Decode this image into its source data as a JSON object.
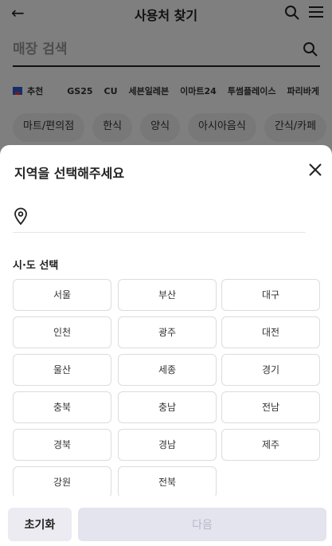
{
  "header": {
    "title": "사용처 찾기",
    "back_icon": "back-arrow-icon",
    "search_icon": "search-icon",
    "menu_icon": "menu-icon"
  },
  "search": {
    "placeholder": "매장 검색",
    "value": ""
  },
  "brands": {
    "recommend_label": "추천",
    "items": [
      "GS25",
      "CU",
      "세븐일레븐",
      "이마트24",
      "투썸플레이스",
      "파리바게"
    ]
  },
  "categories": [
    "마트/편의점",
    "한식",
    "양식",
    "아시아음식",
    "간식/카페"
  ],
  "sheet": {
    "title": "지역을 선택해주세요",
    "close_icon": "close-icon",
    "location_icon": "location-pin-icon",
    "location_value": "",
    "section_title": "시·도 선택",
    "regions": [
      "서울",
      "부산",
      "대구",
      "인천",
      "광주",
      "대전",
      "울산",
      "세종",
      "경기",
      "충북",
      "충남",
      "전남",
      "경북",
      "경남",
      "제주",
      "강원",
      "전북"
    ]
  },
  "footer": {
    "reset_label": "초기화",
    "next_label": "다음"
  },
  "colors": {
    "overlay": "#000000",
    "next_disabled_bg": "#e3e4ee",
    "reset_bg": "#ebebf1",
    "accent_brand": "#2d5bd8"
  }
}
